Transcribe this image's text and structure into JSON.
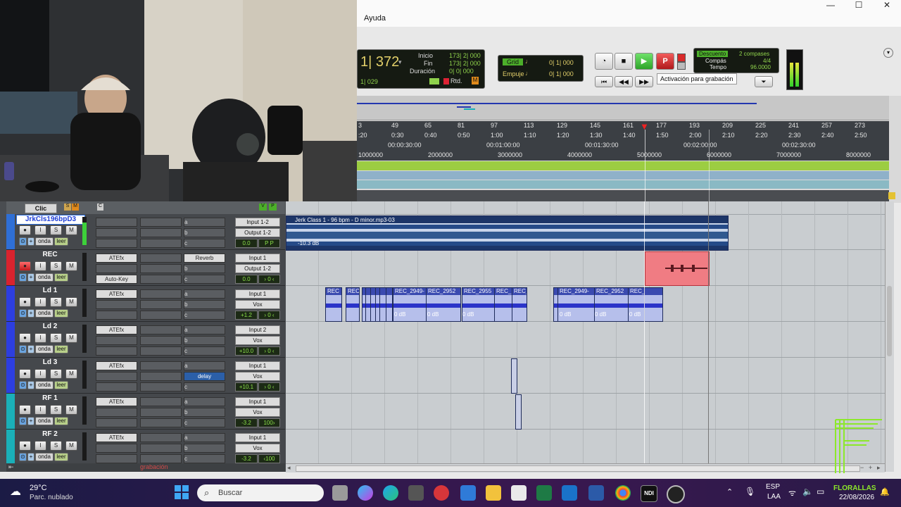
{
  "window": {
    "menu_item": "Ayuda",
    "minimize": "—",
    "maximize": "☐",
    "close": "✕",
    "inner_min": "▭",
    "inner_max": "▢",
    "inner_close": "✕"
  },
  "transport": {
    "main_counter": "1| 372",
    "sub_counter": "1| 029",
    "start_label": "Inicio",
    "start_value": "173| 2| 000",
    "end_label": "Fin",
    "end_value": "173| 2| 000",
    "duration_label": "Duración",
    "duration_value": "0| 0| 000",
    "rtd_label": "Rtd.",
    "grid_label": "Grid",
    "grid_value": "0| 1| 000",
    "nudge_label": "Empuje",
    "nudge_value": "0| 1| 000",
    "countoff_label": "Descuento",
    "countoff_value": "2 compases",
    "meter_label": "Compás",
    "meter_value": "4/4",
    "tempo_label": "Tempo",
    "tempo_value": "96.0000",
    "tooltip": "Activación para grabación"
  },
  "ruler": {
    "bars": [
      "3",
      "49",
      "65",
      "81",
      "97",
      "113",
      "129",
      "145",
      "161",
      "177",
      "193",
      "209",
      "225",
      "241",
      "257",
      "273"
    ],
    "minsecs": [
      ":20",
      "0:30",
      "0:40",
      "0:50",
      "1:00",
      "1:10",
      "1:20",
      "1:30",
      "1:40",
      "1:50",
      "2:00",
      "2:10",
      "2:20",
      "2:30",
      "2:40",
      "2:50"
    ],
    "timecode": [
      "00:00:30:00",
      "00:01:00:00",
      "00:01:30:00",
      "00:02:00:00",
      "00:02:30:00"
    ],
    "samples": [
      "1000000",
      "2000000",
      "3000000",
      "4000000",
      "5000000",
      "6000000",
      "7000000",
      "8000000"
    ]
  },
  "click_track": {
    "name": "Clic",
    "s": "S",
    "m": "M",
    "c": "C",
    "v": "V",
    "p": "P"
  },
  "tracks": [
    {
      "name": "JrkCls196bpD3",
      "color": "#2f6fd6",
      "insert": "",
      "insert2": "",
      "send": "a",
      "send_b": "b",
      "send_c": "c",
      "input": "Input 1-2",
      "output": "Output 1-2",
      "volume": "0.0",
      "pan": "P   P",
      "mode": "onda",
      "lee": "leer"
    },
    {
      "name": "REC",
      "color": "#d9232e",
      "insert": "ATEfx",
      "insert2": "Auto-Key",
      "send": "Reverb",
      "send_b": "b",
      "send_c": "c",
      "input": "Input 1",
      "output": "Output 1-2",
      "volume": "0.0",
      "pan": "› 0 ‹",
      "mode": "onda",
      "lee": "leer"
    },
    {
      "name": "Ld 1",
      "color": "#2d3ee0",
      "insert": "ATEfx",
      "insert2": "",
      "send": "a",
      "send_b": "b",
      "send_c": "c",
      "input": "Input 1",
      "output": "Vox",
      "volume": "+1.2",
      "pan": "› 0 ‹",
      "mode": "onda",
      "lee": "leer"
    },
    {
      "name": "Ld 2",
      "color": "#2d3ee0",
      "insert": "ATEfx",
      "insert2": "",
      "send": "a",
      "send_b": "b",
      "send_c": "c",
      "input": "Input 2",
      "output": "Vox",
      "volume": "+10.0",
      "pan": "› 0 ‹",
      "mode": "onda",
      "lee": "leer"
    },
    {
      "name": "Ld 3",
      "color": "#2d3ee0",
      "insert": "ATEfx",
      "insert2": "",
      "send": "a",
      "send_b": "delay",
      "send_c": "c",
      "input": "Input 1",
      "output": "Vox",
      "volume": "+10.1",
      "pan": "› 0 ‹",
      "mode": "onda",
      "lee": "leer"
    },
    {
      "name": "RF 1",
      "color": "#1ab0b8",
      "insert": "ATEfx",
      "insert2": "",
      "send": "a",
      "send_b": "b",
      "send_c": "c",
      "input": "Input 1",
      "output": "Vox",
      "volume": "-3.2",
      "pan": "100›",
      "mode": "onda",
      "lee": "leer"
    },
    {
      "name": "RF 2",
      "color": "#1ab0b8",
      "insert": "ATEfx",
      "insert2": "",
      "send": "a",
      "send_b": "b",
      "send_c": "c",
      "input": "Input 1",
      "output": "Vox",
      "volume": "-3.2",
      "pan": "‹100",
      "mode": "onda",
      "lee": "leer"
    }
  ],
  "mixer_footer": "grabación",
  "clips": {
    "beat_name": "Jerk Class 1 - 96 bpm - D minor.mp3-03",
    "beat_gain": "-10.3 dB",
    "ld1_labels": [
      "REC",
      "REC",
      "REC_2949-",
      "REC_2952",
      "REC_2955",
      "REC_",
      "REC_",
      "REC_2949-",
      "REC_2952",
      "REC_2952"
    ],
    "ld1_gains": [
      "0 dB",
      "0 dB",
      "0 dB",
      "0 dB",
      "0 dB",
      "0 dB"
    ]
  },
  "taskbar": {
    "temp": "29°C",
    "weather": "Parc. nublado",
    "search_placeholder": "Buscar",
    "lang1": "ESP",
    "lang2": "LAA",
    "time": "FLORALLAS",
    "date": "22/08/2026"
  }
}
